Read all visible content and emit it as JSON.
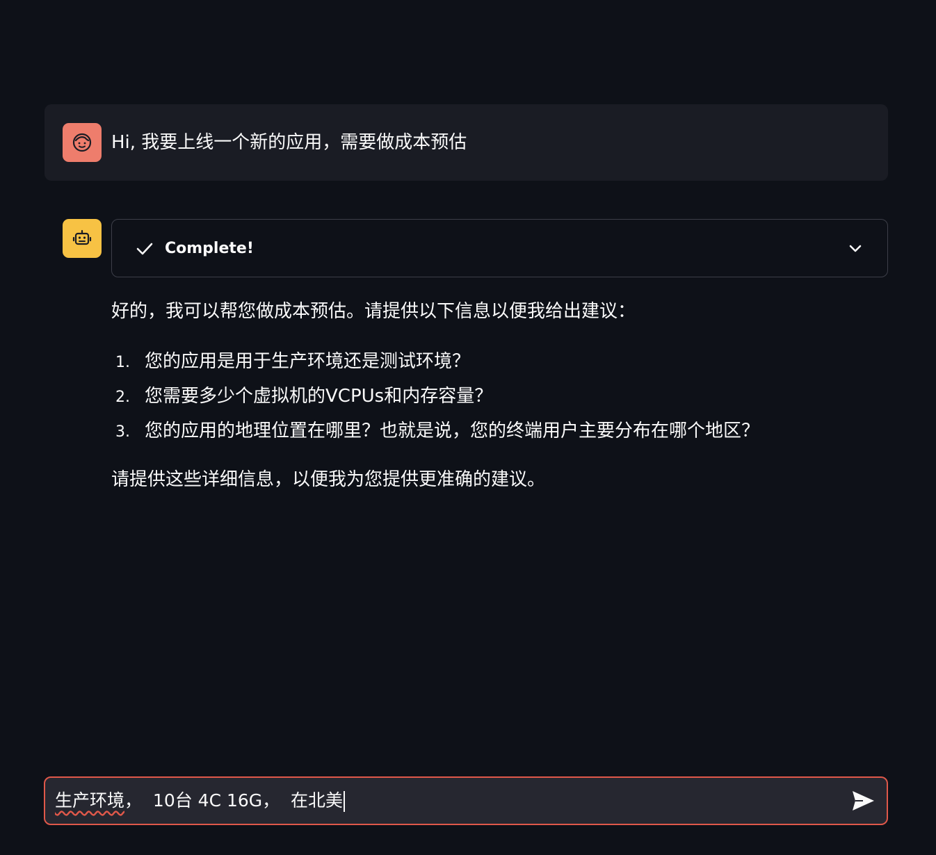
{
  "user_message": {
    "text": "Hi, 我要上线一个新的应用，需要做成本预估",
    "avatar_icon": "user-face-icon",
    "avatar_color": "#ee7d6c"
  },
  "assistant": {
    "avatar_icon": "robot-icon",
    "avatar_color": "#f7c244",
    "status": {
      "label": "Complete!",
      "icon": "check-icon",
      "toggle_icon": "chevron-down-icon"
    },
    "intro": "好的，我可以帮您做成本预估。请提供以下信息以便我给出建议：",
    "questions": [
      {
        "number": "1.",
        "text": "您的应用是用于生产环境还是测试环境？"
      },
      {
        "number": "2.",
        "text": "您需要多少个虚拟机的VCPUs和内存容量？"
      },
      {
        "number": "3.",
        "text": "您的应用的地理位置在哪里？也就是说，您的终端用户主要分布在哪个地区？"
      }
    ],
    "outro": "请提供这些详细信息，以便我为您提供更准确的建议。"
  },
  "chat_input": {
    "value_misspelled": "生产环境",
    "value_rest": "，  10台 4C 16G，  在北美",
    "send_icon": "send-icon",
    "border_color": "#e0584a"
  }
}
